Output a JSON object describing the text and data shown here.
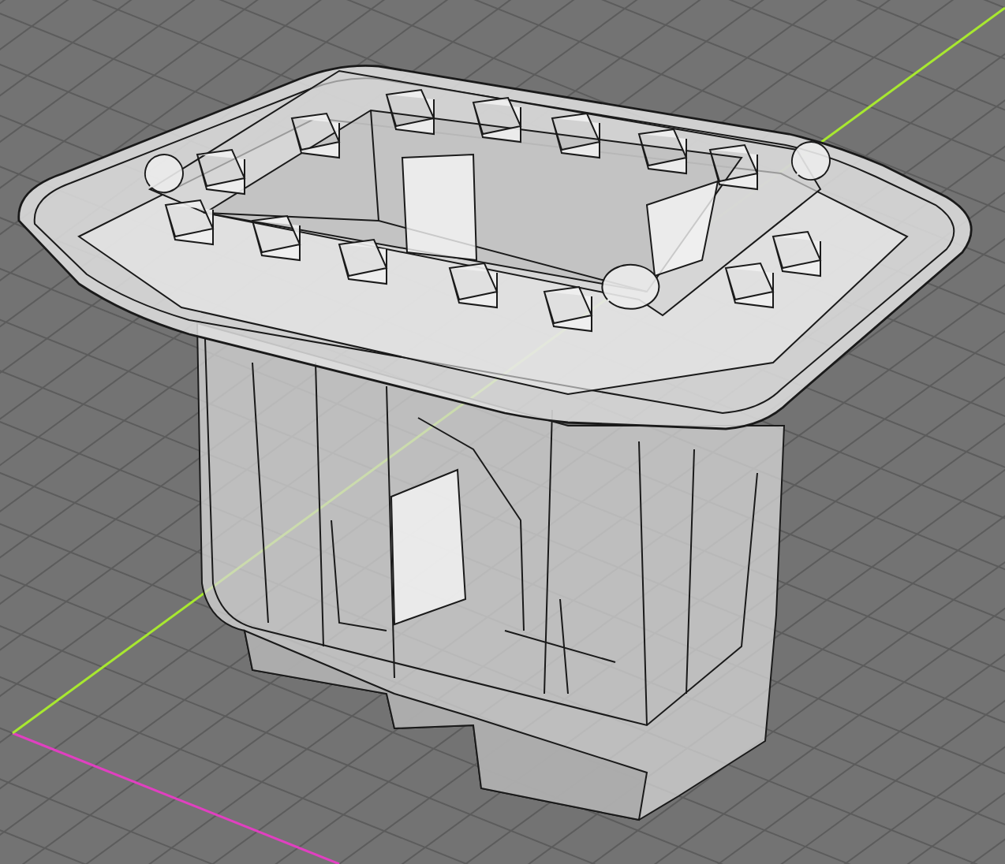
{
  "viewport": {
    "axes": [
      {
        "kind": "x",
        "color": "#e040c0"
      },
      {
        "kind": "y",
        "color": "#a8e830"
      }
    ]
  }
}
